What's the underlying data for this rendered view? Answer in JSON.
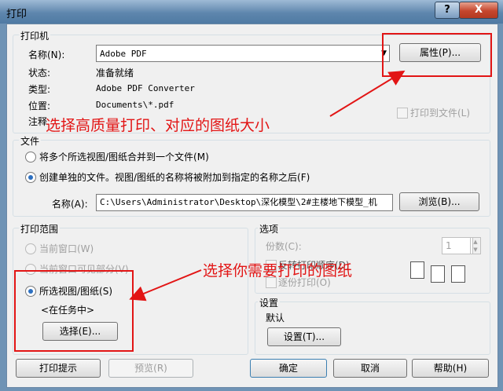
{
  "window": {
    "title": "打印",
    "help": "?",
    "close": "X"
  },
  "printer": {
    "group": "打印机",
    "name_label": "名称(N):",
    "name_value": "Adobe PDF",
    "properties_btn": "属性(P)...",
    "status_label": "状态:",
    "status_value": "准备就绪",
    "type_label": "类型:",
    "type_value": "Adobe PDF Converter",
    "location_label": "位置:",
    "location_value": "Documents\\*.pdf",
    "comment_label": "注释",
    "print_to_file": "打印到文件(L)"
  },
  "file": {
    "group": "文件",
    "merge_option": "将多个所选视图/图纸合并到一个文件(M)",
    "separate_option": "创建单独的文件。视图/图纸的名称将被附加到指定的名称之后(F)",
    "name_label": "名称(A):",
    "name_value": "C:\\Users\\Administrator\\Desktop\\深化模型\\2#主楼地下模型_机",
    "browse_btn": "浏览(B)..."
  },
  "range": {
    "group": "打印范围",
    "current_window": "当前窗口(W)",
    "visible_part": "当前窗口可见部分(V)",
    "selected_views": "所选视图/图纸(S)",
    "in_task": "<在任务中>",
    "select_btn": "选择(E)..."
  },
  "options": {
    "group": "选项",
    "copies_label": "份数(C):",
    "copies_value": "1",
    "reverse_order": "反转打印顺序(D)",
    "collate": "逐份打印(O)"
  },
  "settings": {
    "group": "设置",
    "default_label": "默认",
    "settings_btn": "设置(T)..."
  },
  "footer": {
    "tips_btn": "打印提示",
    "preview_btn": "预览(R)",
    "ok_btn": "确定",
    "cancel_btn": "取消",
    "help_btn": "帮助(H)"
  },
  "annotations": {
    "top": "选择高质量打印、对应的图纸大小",
    "bottom": "选择你需要打印的图纸"
  },
  "colors": {
    "annotation": "#e21515",
    "dialog_bg": "#f0f0f0",
    "titlebar": "#5e86ad"
  }
}
